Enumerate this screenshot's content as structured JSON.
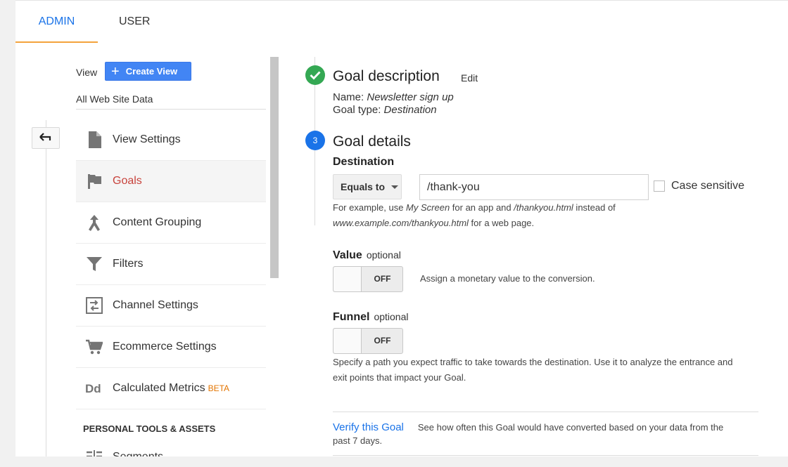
{
  "tabs": [
    {
      "label": "ADMIN",
      "active": true
    },
    {
      "label": "USER",
      "active": false
    }
  ],
  "sidebar": {
    "view_label": "View",
    "create_view_label": "Create View",
    "view_name": "All Web Site Data",
    "items": [
      {
        "label": "View Settings",
        "icon": "document-icon"
      },
      {
        "label": "Goals",
        "icon": "flag-icon",
        "active": true
      },
      {
        "label": "Content Grouping",
        "icon": "merge-icon"
      },
      {
        "label": "Filters",
        "icon": "filter-icon"
      },
      {
        "label": "Channel Settings",
        "icon": "channel-icon"
      },
      {
        "label": "Ecommerce Settings",
        "icon": "cart-icon"
      },
      {
        "label": "Calculated Metrics",
        "icon": "dd-icon",
        "badge": "BETA"
      }
    ],
    "section_header": "PERSONAL TOOLS & ASSETS",
    "section_items": [
      {
        "label": "Segments",
        "icon": "segments-icon"
      }
    ]
  },
  "main": {
    "goal_description": {
      "title": "Goal description",
      "edit_label": "Edit",
      "name_label": "Name:",
      "name_value": "Newsletter sign up",
      "type_label": "Goal type:",
      "type_value": "Destination"
    },
    "goal_details": {
      "step_number": "3",
      "title": "Goal details",
      "destination_label": "Destination",
      "match_type": "Equals to",
      "destination_value": "/thank-you",
      "case_sensitive_label": "Case sensitive",
      "help": {
        "p1": "For example, use ",
        "e1": "My Screen",
        "p2": " for an app and ",
        "e2": "/thankyou.html",
        "p3": " instead of",
        "e3": "www.example.com/thankyou.html",
        "p4": " for a web page."
      },
      "value_label": "Value",
      "value_optional": "optional",
      "value_toggle": "OFF",
      "value_desc": "Assign a monetary value to the conversion.",
      "funnel_label": "Funnel",
      "funnel_optional": "optional",
      "funnel_toggle": "OFF",
      "funnel_desc_1": "Specify a path you expect traffic to take towards the destination. Use it to analyze the entrance and",
      "funnel_desc_2": "exit points that impact your Goal."
    },
    "verify": {
      "link_label": "Verify this Goal",
      "desc_1": "See how often this Goal would have converted based on your data from the",
      "desc_2": "past 7 days."
    }
  },
  "colors": {
    "accent_blue": "#1a73e8",
    "tab_underline": "#f4a33c",
    "active_item": "#c8433c",
    "success_green": "#34a853",
    "beta": "#e37400"
  }
}
